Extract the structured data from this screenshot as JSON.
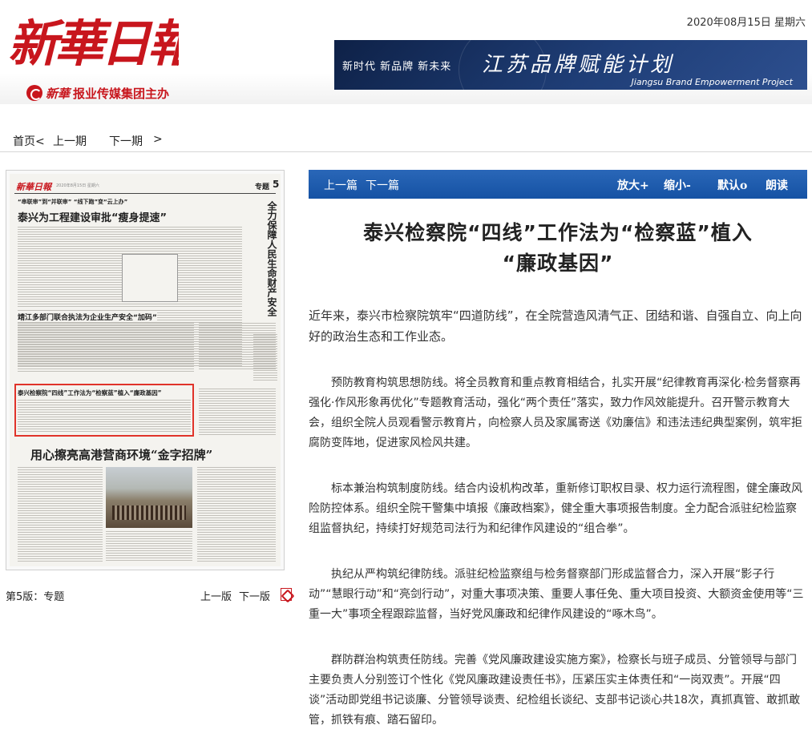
{
  "header": {
    "logo_text": "新華日報",
    "sub_brand": "新華",
    "sub_text": "报业传媒集团主办",
    "date": "2020年08月15日",
    "weekday": "星期六",
    "banner": {
      "slogan": "新时代  新品牌  新未来",
      "title": "江苏品牌赋能计划",
      "subtitle": "Jiangsu Brand Empowerment Project"
    }
  },
  "nav": {
    "home": "首页<",
    "prev": "上一期",
    "next": "下一期",
    "arrow": ">"
  },
  "thumbnail": {
    "masthead": "新華日報",
    "section": "专题",
    "page_no": "5",
    "headlines": [
      "“串联审”到“并联审” “线下跑”变“云上办”",
      "泰兴为工程建设审批“瘦身提速”",
      "全力保障人民生命财产安全",
      "靖江多部门联合执法为企业生产安全“加码”",
      "泰兴检察院“四线”工作法为“检察蓝”植入“廉政基因”",
      "用心擦亮高港营商环境“金字招牌”"
    ],
    "page_label": "第5版：专题",
    "prev_page": "上一版",
    "next_page": "下一版",
    "pdf_icon": "pdf-icon"
  },
  "toolbar": {
    "prev": "上一篇",
    "next": "下一篇",
    "zoom_in": "放大+",
    "zoom_out": "缩小-",
    "reset": "默认o",
    "read": "朗读"
  },
  "article": {
    "title_line1": "泰兴检察院“四线”工作法为“检察蓝”植入",
    "title_line2": "“廉政基因”",
    "lead": "近年来，泰兴市检察院筑牢“四道防线”，在全院营造风清气正、团结和谐、自强自立、向上向好的政治生态和工作业态。",
    "paragraphs": [
      "预防教育构筑思想防线。将全员教育和重点教育相结合，扎实开展“纪律教育再深化·检务督察再强化·作风形象再优化”专题教育活动，强化“两个责任”落实，致力作风效能提升。召开警示教育大会，组织全院人员观看警示教育片，向检察人员及家属寄送《劝廉信》和违法违纪典型案例，筑牢拒腐防变阵地，促进家风检风共建。",
      "标本兼治构筑制度防线。结合内设机构改革，重新修订职权目录、权力运行流程图，健全廉政风险防控体系。组织全院干警集中填报《廉政档案》，健全重大事项报告制度。全力配合派驻纪检监察组监督执纪，持续打好规范司法行为和纪律作风建设的“组合拳”。",
      "执纪从严构筑纪律防线。派驻纪检监察组与检务督察部门形成监督合力，深入开展“影子行动”“慧眼行动”和“亮剑行动”，对重大事项决策、重要人事任免、重大项目投资、大额资金使用等“三重一大”事项全程跟踪监督，当好党风廉政和纪律作风建设的“啄木鸟”。",
      "群防群治构筑责任防线。完善《党风廉政建设实施方案》，检察长与班子成员、分管领导与部门主要负责人分别签订个性化《党风廉政建设责任书》，压紧压实主体责任和“一岗双责”。开展“四谈”活动即党组书记谈廉、分管领导谈责、纪检组长谈纪、支部书记谈心共18次，真抓真管、敢抓敢管，抓铁有痕、踏石留印。"
    ]
  },
  "colors": {
    "brand_red": "#c8161d",
    "toolbar_blue": "#1a57a8",
    "highlight_red": "#e0332a"
  }
}
